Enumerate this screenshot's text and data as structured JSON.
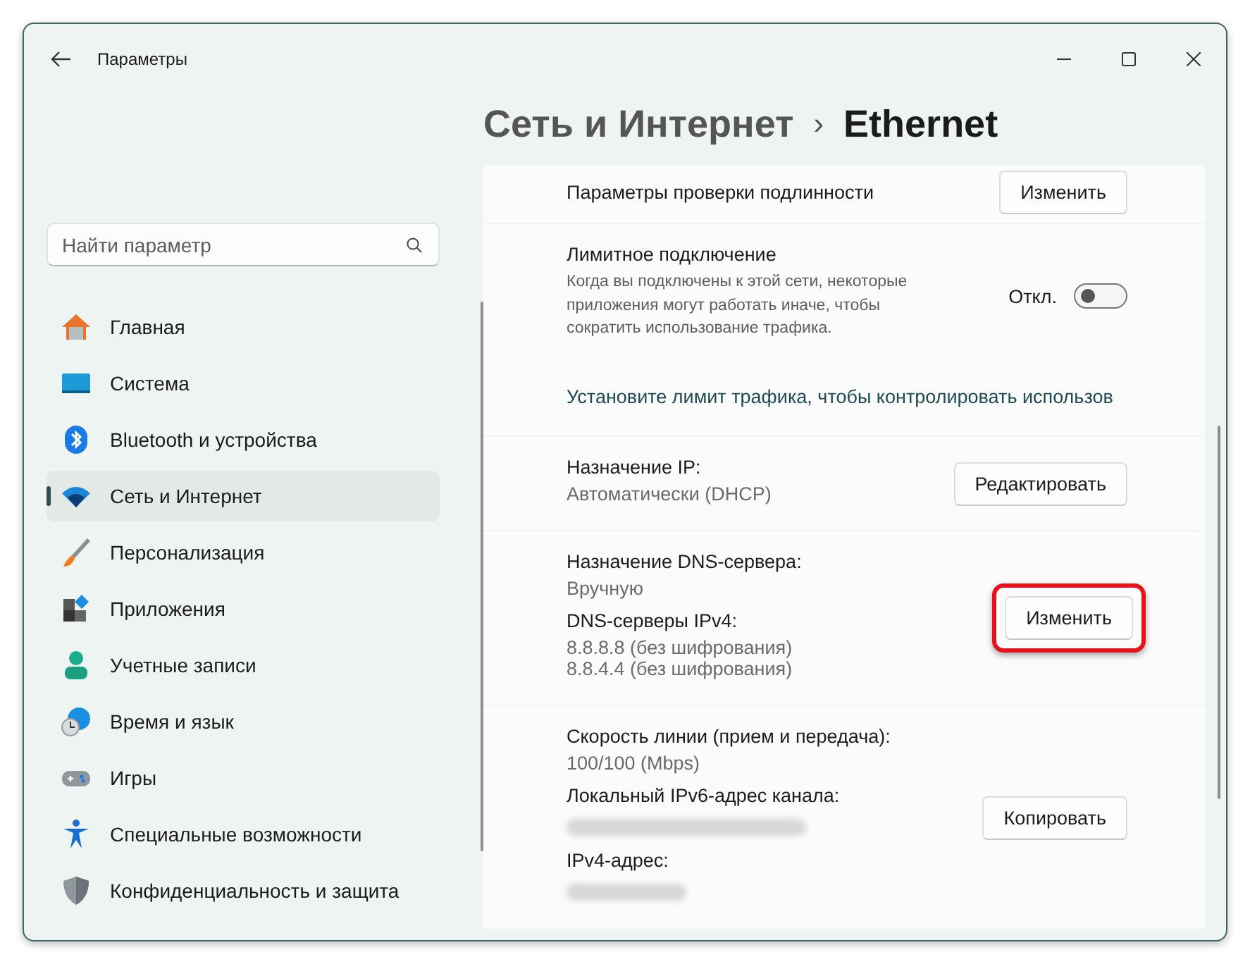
{
  "window": {
    "title": "Параметры"
  },
  "search": {
    "placeholder": "Найти параметр"
  },
  "sidebar": {
    "items": [
      {
        "label": "Главная",
        "selected": false
      },
      {
        "label": "Система",
        "selected": false
      },
      {
        "label": "Bluetooth и устройства",
        "selected": false
      },
      {
        "label": "Сеть и Интернет",
        "selected": true
      },
      {
        "label": "Персонализация",
        "selected": false
      },
      {
        "label": "Приложения",
        "selected": false
      },
      {
        "label": "Учетные записи",
        "selected": false
      },
      {
        "label": "Время и язык",
        "selected": false
      },
      {
        "label": "Игры",
        "selected": false
      },
      {
        "label": "Специальные возможности",
        "selected": false
      },
      {
        "label": "Конфиденциальность и защита",
        "selected": false
      }
    ]
  },
  "breadcrumb": {
    "parent": "Сеть и Интернет",
    "separator": "›",
    "current": "Ethernet"
  },
  "cards": [
    {
      "kind": "fields",
      "fields": [
        {
          "label": "Параметры проверки подлинности"
        }
      ],
      "button": {
        "label": "Изменить",
        "highlighted": false
      }
    },
    {
      "kind": "toggle",
      "title": "Лимитное подключение",
      "description": "Когда вы подключены к этой сети, некоторые приложения могут работать иначе, чтобы сократить использование трафика.",
      "toggle": {
        "label": "Откл.",
        "on": false
      },
      "link": "Установите лимит трафика, чтобы контролировать использов"
    },
    {
      "kind": "fields",
      "fields": [
        {
          "label": "Назначение IP:",
          "values": [
            "Автоматически (DHCP)"
          ]
        }
      ],
      "button": {
        "label": "Редактировать",
        "highlighted": false
      }
    },
    {
      "kind": "fields",
      "fields": [
        {
          "label": "Назначение DNS-сервера:",
          "values": [
            "Вручную"
          ]
        },
        {
          "label": "DNS-серверы IPv4:",
          "values": [
            "8.8.8.8 (без шифрования)",
            "8.8.4.4 (без шифрования)"
          ]
        }
      ],
      "button": {
        "label": "Изменить",
        "highlighted": true
      }
    },
    {
      "kind": "fields",
      "fields": [
        {
          "label": "Скорость линии (прием и передача):",
          "values": [
            "100/100 (Mbps)"
          ]
        },
        {
          "label": "Локальный IPv6-адрес канала:",
          "redacted": true
        },
        {
          "label": "IPv4-адрес:",
          "redacted": true
        }
      ],
      "button": {
        "label": "Копировать",
        "highlighted": false
      }
    }
  ]
}
